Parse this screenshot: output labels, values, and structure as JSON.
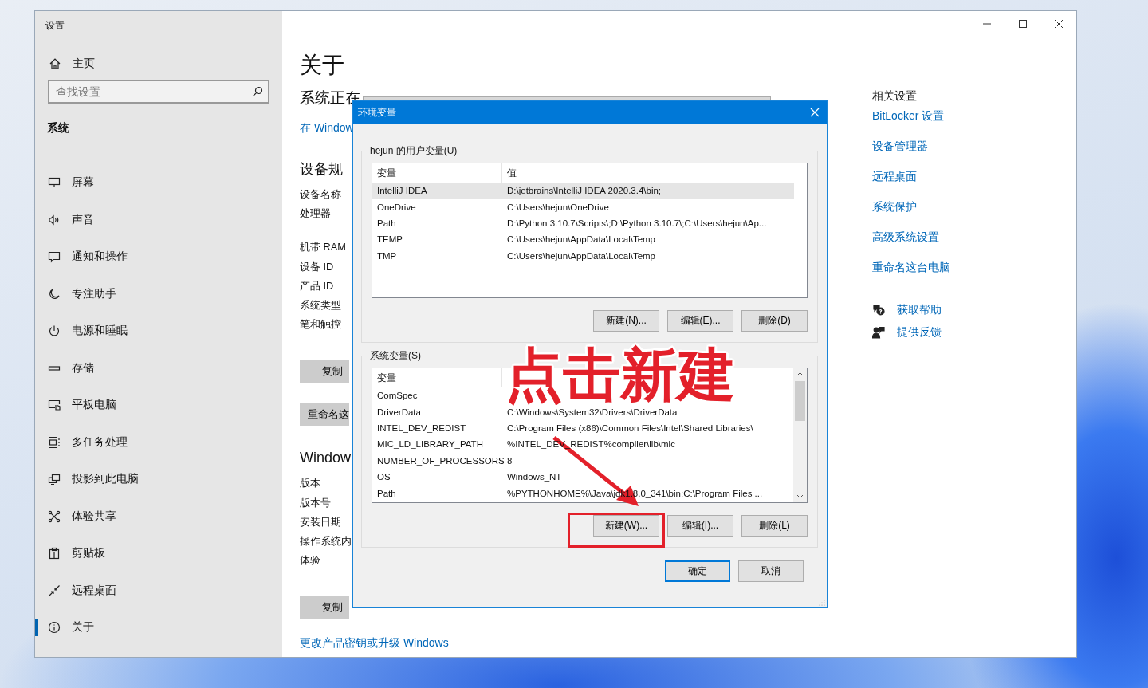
{
  "window": {
    "title": "设置"
  },
  "sidebar": {
    "home": "主页",
    "search": {
      "placeholder": "查找设置"
    },
    "section": "系统",
    "items": [
      {
        "label": "屏幕",
        "selected": false
      },
      {
        "label": "声音",
        "selected": false
      },
      {
        "label": "通知和操作",
        "selected": false
      },
      {
        "label": "专注助手",
        "selected": false
      },
      {
        "label": "电源和睡眠",
        "selected": false
      },
      {
        "label": "存储",
        "selected": false
      },
      {
        "label": "平板电脑",
        "selected": false
      },
      {
        "label": "多任务处理",
        "selected": false
      },
      {
        "label": "投影到此电脑",
        "selected": false
      },
      {
        "label": "体验共享",
        "selected": false
      },
      {
        "label": "剪贴板",
        "selected": false
      },
      {
        "label": "远程桌面",
        "selected": false
      },
      {
        "label": "关于",
        "selected": true
      }
    ]
  },
  "about": {
    "title": "关于",
    "status": "系统正在",
    "link": "在 Window",
    "sections": [
      {
        "heading": "设备规",
        "groups": [
          [
            "设备名称",
            "处理器"
          ],
          [
            "机带 RAM",
            "设备 ID",
            "产品 ID",
            "系统类型",
            "笔和触控"
          ]
        ],
        "buttons": [
          "复制",
          "重命名这"
        ]
      },
      {
        "heading": "Window",
        "groups": [
          [
            "版本",
            "版本号",
            "安装日期",
            "操作系统内",
            "体验"
          ]
        ],
        "buttons": [
          "复制"
        ]
      }
    ],
    "footer_link": "更改产品密钥或升级 Windows"
  },
  "related": {
    "heading": "相关设置",
    "links": [
      "BitLocker 设置",
      "设备管理器",
      "远程桌面",
      "系统保护",
      "高级系统设置",
      "重命名这台电脑"
    ],
    "help": [
      {
        "label": "获取帮助"
      },
      {
        "label": "提供反馈"
      }
    ]
  },
  "dialog": {
    "title": "环境变量",
    "groups": [
      {
        "label": "hejun 的用户变量(U)",
        "scrollable": false,
        "columns": [
          "变量",
          "值"
        ],
        "rows": [
          {
            "name": "IntelliJ IDEA",
            "value": "D:\\jetbrains\\IntelliJ IDEA 2020.3.4\\bin;",
            "selected": true
          },
          {
            "name": "OneDrive",
            "value": "C:\\Users\\hejun\\OneDrive",
            "selected": false
          },
          {
            "name": "Path",
            "value": "D:\\Python 3.10.7\\Scripts\\;D:\\Python 3.10.7\\;C:\\Users\\hejun\\Ap...",
            "selected": false
          },
          {
            "name": "TEMP",
            "value": "C:\\Users\\hejun\\AppData\\Local\\Temp",
            "selected": false
          },
          {
            "name": "TMP",
            "value": "C:\\Users\\hejun\\AppData\\Local\\Temp",
            "selected": false
          }
        ],
        "buttons": [
          "新建(N)...",
          "编辑(E)...",
          "删除(D)"
        ]
      },
      {
        "label": "系统变量(S)",
        "scrollable": true,
        "columns": [
          "变量"
        ],
        "rows": [
          {
            "name": "ComSpec",
            "selected": false
          },
          {
            "name": "DriverData",
            "value": "C:\\Windows\\System32\\Drivers\\DriverData",
            "selected": false
          },
          {
            "name": "INTEL_DEV_REDIST",
            "value": "C:\\Program Files (x86)\\Common Files\\Intel\\Shared Libraries\\",
            "selected": false
          },
          {
            "name": "MIC_LD_LIBRARY_PATH",
            "value": "%INTEL_DEV_REDIST%compiler\\lib\\mic",
            "selected": false
          },
          {
            "name": "NUMBER_OF_PROCESSORS",
            "value": "8",
            "selected": false
          },
          {
            "name": "OS",
            "value": "Windows_NT",
            "selected": false
          },
          {
            "name": "Path",
            "value": "%PYTHONHOME%\\Java\\jdk1.8.0_341\\bin;C:\\Program Files ...",
            "selected": false
          }
        ],
        "buttons": [
          "新建(W)...",
          "编辑(I)...",
          "删除(L)"
        ]
      }
    ],
    "footer_buttons": [
      {
        "label": "确定",
        "default": true
      },
      {
        "label": "取消",
        "default": false
      }
    ]
  },
  "annotation": {
    "text": "点击新建"
  }
}
